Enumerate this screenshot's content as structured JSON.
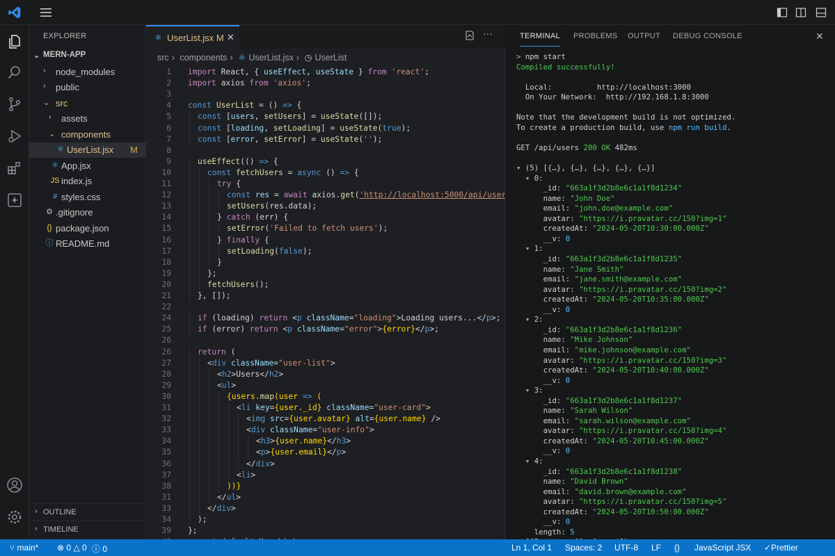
{
  "sidebar": {
    "title": "EXPLORER",
    "project": "MERN-APP",
    "items": [
      {
        "label": "node_modules",
        "kind": "folder",
        "open": false,
        "depth": 1
      },
      {
        "label": "public",
        "kind": "folder",
        "open": false,
        "depth": 1
      },
      {
        "label": "src",
        "kind": "folder",
        "open": true,
        "depth": 1
      },
      {
        "label": "assets",
        "kind": "folder",
        "open": false,
        "depth": 2
      },
      {
        "label": "components",
        "kind": "folder",
        "open": true,
        "depth": 2
      },
      {
        "label": "UserList.jsx",
        "kind": "jsx",
        "depth": 3,
        "selected": true,
        "mark": "M"
      },
      {
        "label": "App.jsx",
        "kind": "jsx",
        "depth": 2
      },
      {
        "label": "index.js",
        "kind": "js",
        "depth": 2
      },
      {
        "label": "styles.css",
        "kind": "css",
        "depth": 2
      },
      {
        "label": ".gitignore",
        "kind": "gear",
        "depth": 1
      },
      {
        "label": "package.json",
        "kind": "json",
        "depth": 1
      },
      {
        "label": "README.md",
        "kind": "info",
        "depth": 1
      }
    ],
    "sections": [
      "OUTLINE",
      "TIMELINE"
    ]
  },
  "editor": {
    "tab": {
      "label": "UserList.jsx",
      "mark": "M"
    },
    "breadcrumb": [
      "src",
      "components",
      "UserList.jsx",
      "UserList"
    ],
    "lines": [
      {
        "n": "1",
        "i": 0,
        "h": "<span class=\"k\">import</span> React, { <span class=\"v\">useEffect</span>, <span class=\"v\">useState</span> } <span class=\"k\">from</span> <span class=\"s\">'react'</span>;"
      },
      {
        "n": "2",
        "i": 0,
        "h": "<span class=\"k\">import</span> axios <span class=\"k\">from</span> <span class=\"s\">'axios'</span>;"
      },
      {
        "n": "3",
        "i": 0,
        "h": ""
      },
      {
        "n": "4",
        "i": 0,
        "h": "<span class=\"b\">const</span> <span class=\"f\">UserList</span> = () <span class=\"b\">=&gt;</span> {"
      },
      {
        "n": "5",
        "i": 1,
        "h": "<span class=\"b\">const</span> [<span class=\"v\">users</span>, <span class=\"f\">setUsers</span>] = <span class=\"f\">useState</span>([]);"
      },
      {
        "n": "6",
        "i": 1,
        "h": "<span class=\"b\">const</span> [<span class=\"v\">loading</span>, <span class=\"f\">setLoading</span>] = <span class=\"f\">useState</span>(<span class=\"b\">true</span>);"
      },
      {
        "n": "7",
        "i": 1,
        "h": "<span class=\"b\">const</span> [<span class=\"v\">error</span>, <span class=\"f\">setError</span>] = <span class=\"f\">useState</span>(<span class=\"s\">''</span>);"
      },
      {
        "n": "8",
        "i": 0,
        "h": ""
      },
      {
        "n": "9",
        "i": 1,
        "h": "<span class=\"f\">useEffect</span>(() <span class=\"b\">=&gt;</span> {"
      },
      {
        "n": "10",
        "i": 2,
        "h": "<span class=\"b\">const</span> <span class=\"f\">fetchUsers</span> = <span class=\"b\">async</span> () <span class=\"b\">=&gt;</span> {"
      },
      {
        "n": "11",
        "i": 3,
        "h": "<span class=\"k\">try</span> {"
      },
      {
        "n": "12",
        "i": 4,
        "h": "<span class=\"b\">const</span> <span class=\"v\">res</span> = <span class=\"k\">await</span> axios.<span class=\"f\">get</span>(<span class=\"lk\">'http://localhost:5000/api/users'</span>);"
      },
      {
        "n": "13",
        "i": 4,
        "h": "<span class=\"f\">setUsers</span>(res.data);"
      },
      {
        "n": "14",
        "i": 3,
        "h": "} <span class=\"k\">catch</span> (err) {"
      },
      {
        "n": "15",
        "i": 4,
        "h": "<span class=\"f\">setError</span>(<span class=\"s\">'Failed to fetch users'</span>);"
      },
      {
        "n": "16",
        "i": 3,
        "h": "} <span class=\"k\">finally</span> {"
      },
      {
        "n": "17",
        "i": 4,
        "h": "<span class=\"f\">setLoading</span>(<span class=\"b\">false</span>);"
      },
      {
        "n": "18",
        "i": 3,
        "h": "}"
      },
      {
        "n": "19",
        "i": 2,
        "h": "};"
      },
      {
        "n": "20",
        "i": 2,
        "h": "<span class=\"f\">fetchUsers</span>();"
      },
      {
        "n": "21",
        "i": 1,
        "h": "}, []);"
      },
      {
        "n": "22",
        "i": 0,
        "h": ""
      },
      {
        "n": "24",
        "i": 1,
        "h": "<span class=\"k\">if</span> (loading) <span class=\"k\">return</span> &lt;<span class=\"t\">p</span> <span class=\"a\">className</span>=<span class=\"s\">\"loading\"</span>&gt;Loading users...&lt;/<span class=\"t\">p</span>&gt;;"
      },
      {
        "n": "25",
        "i": 1,
        "h": "<span class=\"k\">if</span> (error) <span class=\"k\">return</span> &lt;<span class=\"t\">p</span> <span class=\"a\">className</span>=<span class=\"s\">\"error\"</span>&gt;<span class=\"y\">{error}</span>&lt;/<span class=\"t\">p</span>&gt;;"
      },
      {
        "n": "26",
        "i": 0,
        "h": ""
      },
      {
        "n": "26",
        "i": 1,
        "h": "<span class=\"k\">return</span> ("
      },
      {
        "n": "27",
        "i": 2,
        "h": "&lt;<span class=\"t\">div</span> <span class=\"a\">className</span>=<span class=\"s\">\"user-list\"</span>&gt;"
      },
      {
        "n": "28",
        "i": 3,
        "h": "&lt;<span class=\"t\">h2</span>&gt;Users&lt;/<span class=\"t\">h2</span>&gt;"
      },
      {
        "n": "29",
        "i": 3,
        "h": "&lt;<span class=\"t\">ul</span>&gt;"
      },
      {
        "n": "30",
        "i": 4,
        "h": "<span class=\"y\">{users.<span class=\"f\">map</span>(user <span class=\"b\">=&gt;</span> (</span>"
      },
      {
        "n": "31",
        "i": 5,
        "h": "&lt;<span class=\"t\">li</span> <span class=\"a\">key</span>=<span class=\"y\">{user._id}</span> <span class=\"a\">className</span>=<span class=\"s\">\"user-card\"</span>&gt;"
      },
      {
        "n": "32",
        "i": 6,
        "h": "&lt;<span class=\"t\">img</span> <span class=\"a\">src</span>=<span class=\"y\">{user.avatar}</span> <span class=\"a\">alt</span>=<span class=\"y\">{user.name}</span> /&gt;"
      },
      {
        "n": "33",
        "i": 6,
        "h": "&lt;<span class=\"t\">div</span> <span class=\"a\">className</span>=<span class=\"s\">\"user-info\"</span>&gt;"
      },
      {
        "n": "34",
        "i": 7,
        "h": "&lt;<span class=\"t\">h3</span>&gt;<span class=\"y\">{user.name}</span>&lt;/<span class=\"t\">h3</span>&gt;"
      },
      {
        "n": "35",
        "i": 7,
        "h": "&lt;<span class=\"t\">p</span>&gt;<span class=\"y\">{user.email}</span>&lt;/<span class=\"t\">p</span>&gt;"
      },
      {
        "n": "36",
        "i": 6,
        "h": "&lt;/<span class=\"t\">div</span>&gt;"
      },
      {
        "n": "37",
        "i": 5,
        "h": "&lt;<span class=\"t\">li</span>&gt;"
      },
      {
        "n": "38",
        "i": 4,
        "h": "<span class=\"y\">))}</span>"
      },
      {
        "n": "31",
        "i": 3,
        "h": "&lt;/<span class=\"t\">ul</span>&gt;"
      },
      {
        "n": "33",
        "i": 2,
        "h": "&lt;/<span class=\"t\">div</span>&gt;"
      },
      {
        "n": "34",
        "i": 1,
        "h": ");"
      },
      {
        "n": "39",
        "i": 0,
        "h": "};"
      },
      {
        "n": "40",
        "i": 0,
        "h": "<span class=\"k\">export</span> <span class=\"k\">default</span> UserList;"
      }
    ]
  },
  "panel": {
    "tabs": [
      "TERMINAL",
      "PROBLEMS",
      "OUTPUT",
      "DEBUG CONSOLE"
    ],
    "active_tab": "TERMINAL",
    "terminal": [
      "<span class=\"tm\">&gt;</span> npm start",
      "<span class=\"tg\">Compiled successfully!</span>",
      "",
      "  Local:          http://localhost:3000",
      "  On Your Network:  http://192.168.1.8:3000",
      "",
      "Note that the development build is not optimized.",
      "To create a production build, use <span class=\"tc\">npm run build</span>.",
      "",
      "GET /api/users <span class=\"tg\">200 OK</span> 482ms",
      "",
      "<span class=\"tm\">▾</span> (5) [{…}, {…}, {…}, {…}, {…}]",
      "  <span class=\"tm\">▾</span> 0:",
      "      _id: <span class=\"tg\">\"663a1f3d2b8e6c1a1f8d1234\"</span>",
      "      name: <span class=\"tg\">\"John Doe\"</span>",
      "      email: <span class=\"tg\">\"john.doe@example.com\"</span>",
      "      avatar: <span class=\"tg\">\"https://i.pravatar.cc/150?img=1\"</span>",
      "      createdAt: <span class=\"tg\">\"2024-05-20T10:30:00.000Z\"</span>",
      "      __v: <span class=\"tc\">0</span>",
      "  <span class=\"tm\">▾</span> 1:",
      "      _id: <span class=\"tg\">\"663a1f3d2b8e6c1a1f8d1235\"</span>",
      "      name: <span class=\"tg\">\"Jane Smith\"</span>",
      "      email: <span class=\"tg\">\"jane.smith@example.com\"</span>",
      "      avatar: <span class=\"tg\">\"https://i.pravatar.cc/150?img=2\"</span>",
      "      createdAt: <span class=\"tg\">\"2024-05-20T10:35:00.000Z\"</span>",
      "      __v: <span class=\"tc\">0</span>",
      "  <span class=\"tm\">▾</span> 2:",
      "      _id: <span class=\"tg\">\"663a1f3d2b8e6c1a1f8d1236\"</span>",
      "      name: <span class=\"tg\">\"Mike Johnson\"</span>",
      "      email: <span class=\"tg\">\"mike.johnson@example.com\"</span>",
      "      avatar: <span class=\"tg\">\"https://i.pravatar.cc/150?img=3\"</span>",
      "      createdAt: <span class=\"tg\">\"2024-05-20T10:40:00.000Z\"</span>",
      "      __v: <span class=\"tc\">0</span>",
      "  <span class=\"tm\">▾</span> 3:",
      "      _id: <span class=\"tg\">\"663a1f3d2b8e6c1a1f8d1237\"</span>",
      "      name: <span class=\"tg\">\"Sarah Wilson\"</span>",
      "      email: <span class=\"tg\">\"sarah.wilson@example.com\"</span>",
      "      avatar: <span class=\"tg\">\"https://i.pravatar.cc/150?img=4\"</span>",
      "      createdAt: <span class=\"tg\">\"2024-05-20T10:45:00.000Z\"</span>",
      "      __v: <span class=\"tc\">0</span>",
      "  <span class=\"tm\">▾</span> 4:",
      "      _id: <span class=\"tg\">\"663a1f3d2b8e6c1a1f8d1238\"</span>",
      "      name: <span class=\"tg\">\"David Brown\"</span>",
      "      email: <span class=\"tg\">\"david.brown@example.com\"</span>",
      "      avatar: <span class=\"tg\">\"https://i.pravatar.cc/150?img=5\"</span>",
      "      createdAt: <span class=\"tg\">\"2024-05-20T10:50:00.000Z\"</span>",
      "      __v: <span class=\"tc\">0</span>",
      "    length: <span class=\"tc\">5</span>",
      "<span class=\"tm\">&gt;</span> [[Prototype]]: Array(0)"
    ]
  },
  "statusbar": {
    "branch": "main*",
    "errors": "0",
    "warnings": "0",
    "problems2": "0",
    "position": "Ln 1, Col 1",
    "spaces": "Spaces: 2",
    "encoding": "UTF-8",
    "eol": "LF",
    "braces": "{}",
    "language": "JavaScript JSX",
    "formatter": "Prettier"
  },
  "colors": {
    "accent": "#0a73c9",
    "tab_active_border": "#3b8eea",
    "modified": "#e2c08d"
  }
}
